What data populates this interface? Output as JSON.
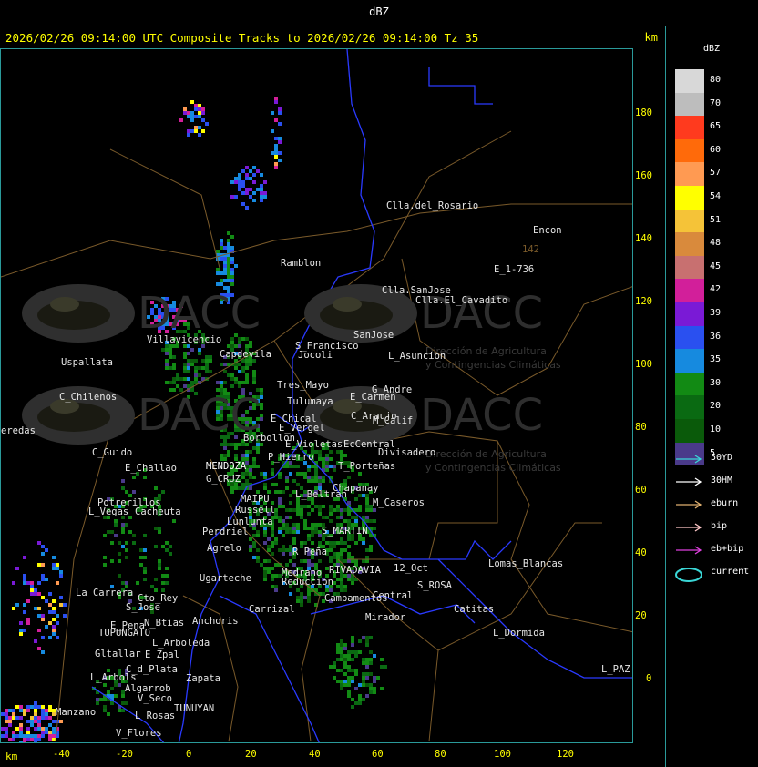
{
  "window_title": "dBZ",
  "header": {
    "title": "2026/02/26 09:14:00 UTC Composite Tracks to 2026/02/26 09:14:00 Tz 35",
    "unit": "km"
  },
  "axes": {
    "x_unit": "km",
    "x_ticks": [
      "-40",
      "-20",
      "0",
      "20",
      "40",
      "60",
      "80",
      "100",
      "120"
    ],
    "y_ticks": [
      "180",
      "160",
      "140",
      "120",
      "100",
      "80",
      "60",
      "40",
      "20",
      "0"
    ]
  },
  "legend": {
    "title": "dBZ",
    "scale": [
      {
        "value": "80",
        "color": "#d8d8d8"
      },
      {
        "value": "70",
        "color": "#bdbdbd"
      },
      {
        "value": "65",
        "color": "#ff3a1e"
      },
      {
        "value": "60",
        "color": "#ff6a0a"
      },
      {
        "value": "57",
        "color": "#ff9a52"
      },
      {
        "value": "54",
        "color": "#ffff00"
      },
      {
        "value": "51",
        "color": "#f5c338"
      },
      {
        "value": "48",
        "color": "#d98a3c"
      },
      {
        "value": "45",
        "color": "#c87070"
      },
      {
        "value": "42",
        "color": "#d21f9a"
      },
      {
        "value": "39",
        "color": "#7a1ad6"
      },
      {
        "value": "36",
        "color": "#2a50f0"
      },
      {
        "value": "35",
        "color": "#168adf"
      },
      {
        "value": "30",
        "color": "#128a14"
      },
      {
        "value": "20",
        "color": "#0a6a12"
      },
      {
        "value": "10",
        "color": "#0a5a0a"
      },
      {
        "value": "5",
        "color": "#4a3a8a"
      }
    ],
    "tracks": [
      {
        "label": "50YD",
        "color": "#3ad6d6",
        "kind": "arrow"
      },
      {
        "label": "30HM",
        "color": "#ffffff",
        "kind": "arrow"
      },
      {
        "label": "eburn",
        "color": "#e0b070",
        "kind": "arrow"
      },
      {
        "label": "bip",
        "color": "#ffc8c8",
        "kind": "arrow"
      },
      {
        "label": "eb+bip",
        "color": "#e040e0",
        "kind": "arrow"
      },
      {
        "label": "current",
        "color": "#3ad6d6",
        "kind": "ellipse"
      }
    ]
  },
  "watermark": {
    "brand": "DACC",
    "subtitle_line1": "Dirección de Agricultura",
    "subtitle_line2": "y Contingencias Climáticas"
  },
  "places": [
    {
      "name": "Clla.del_Rosario"
    },
    {
      "name": "Encon"
    },
    {
      "name": "142"
    },
    {
      "name": "E_1-736"
    },
    {
      "name": "Ramblon"
    },
    {
      "name": "Clla.SanJose"
    },
    {
      "name": "Clla.El_Cavadito"
    },
    {
      "name": "Villavicencio"
    },
    {
      "name": "S_Francisco"
    },
    {
      "name": "SanJose"
    },
    {
      "name": "Uspallata"
    },
    {
      "name": "Capdevila"
    },
    {
      "name": "L_Asuncion"
    },
    {
      "name": "C_Chilenos"
    },
    {
      "name": "Tres_Mayo"
    },
    {
      "name": "G_Andre"
    },
    {
      "name": "Tulumaya"
    },
    {
      "name": "E_Carmen"
    },
    {
      "name": "E_Chical"
    },
    {
      "name": "C_Araujo"
    },
    {
      "name": "E_Vergel"
    },
    {
      "name": "M_Calif"
    },
    {
      "name": "eredas"
    },
    {
      "name": "Borbollon"
    },
    {
      "name": "E_Violetas"
    },
    {
      "name": "EcCentral"
    },
    {
      "name": "Divisadero"
    },
    {
      "name": "C_Guido"
    },
    {
      "name": "P_Hierro"
    },
    {
      "name": "E_Challao"
    },
    {
      "name": "MENDOZA"
    },
    {
      "name": "T_Porteñas"
    },
    {
      "name": "G_CRUZ"
    },
    {
      "name": "Chapanay"
    },
    {
      "name": "Potrerillos"
    },
    {
      "name": "MAIPU"
    },
    {
      "name": "L_Beltran"
    },
    {
      "name": "L_Vegas"
    },
    {
      "name": "Cacheuta"
    },
    {
      "name": "Russell"
    },
    {
      "name": "M_Caseros"
    },
    {
      "name": "Ugarteche"
    },
    {
      "name": "Perdriel"
    },
    {
      "name": "S_MARTIN"
    },
    {
      "name": "Agrelo"
    },
    {
      "name": "R_Peña"
    },
    {
      "name": "RIVADAVIA"
    },
    {
      "name": "12_Oct"
    },
    {
      "name": "Lomas_Blancas"
    },
    {
      "name": "Medrano"
    },
    {
      "name": "Reduccion"
    },
    {
      "name": "S_ROSA"
    },
    {
      "name": "La_Carrera"
    },
    {
      "name": "Cto_Rey"
    },
    {
      "name": "S_Jose"
    },
    {
      "name": "Campamentos"
    },
    {
      "name": "Central"
    },
    {
      "name": "Catitas"
    },
    {
      "name": "Carrizal"
    },
    {
      "name": "E_Pena"
    },
    {
      "name": "TUPUNGATO"
    },
    {
      "name": "Anchoris"
    },
    {
      "name": "Mirador"
    },
    {
      "name": "L_Dormida"
    },
    {
      "name": "N_Btias"
    },
    {
      "name": "L_Arboleda"
    },
    {
      "name": "Gltallar"
    },
    {
      "name": "E_Zpal"
    },
    {
      "name": "C_d_Plata"
    },
    {
      "name": "L_Arbols"
    },
    {
      "name": "Zapata"
    },
    {
      "name": "Algarrob"
    },
    {
      "name": "V_Seco"
    },
    {
      "name": "TUNUYAN"
    },
    {
      "name": "Manzano"
    },
    {
      "name": "L_Rosas"
    },
    {
      "name": "V_Flores"
    },
    {
      "name": "L_PAZ"
    },
    {
      "name": "Jocoli"
    },
    {
      "name": "Lunlunta"
    }
  ]
}
